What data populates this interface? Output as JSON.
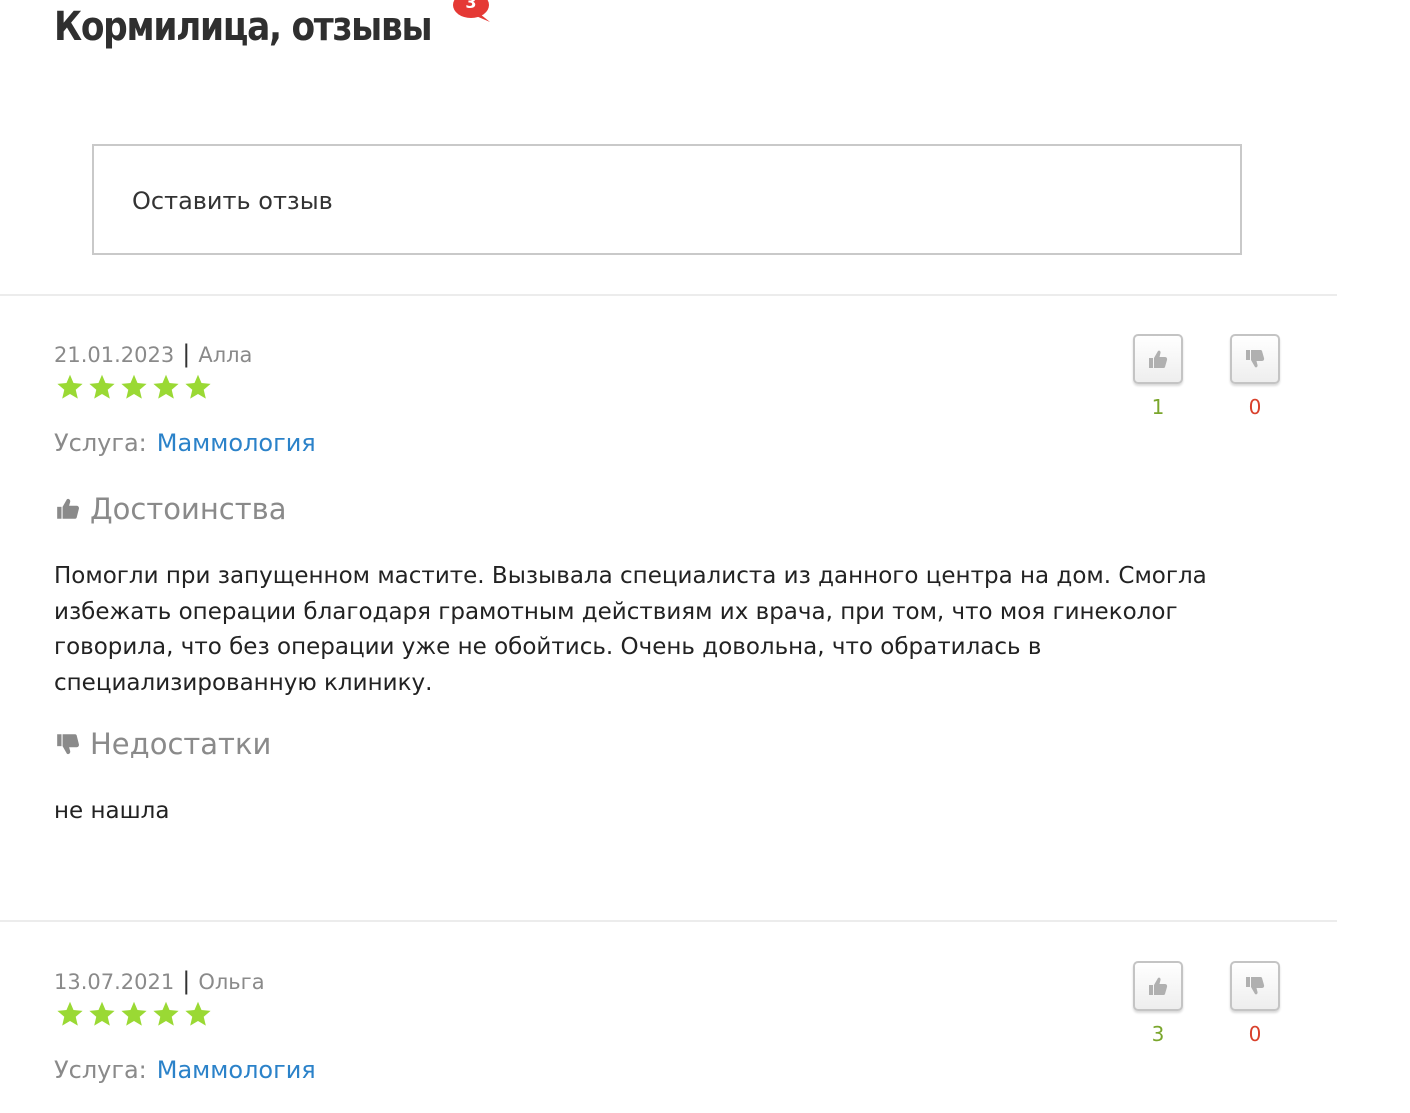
{
  "page": {
    "title": "Кормилица, отзывы",
    "badge_count": "3",
    "leave_review_label": "Оставить отзыв",
    "colors": {
      "star": "#9ad934",
      "link": "#2b82c9",
      "upvote": "#7aa62c",
      "downvote": "#d9402b",
      "badge": "#e53935"
    }
  },
  "reviews": [
    {
      "date": "21.01.2023",
      "author": "Алла",
      "rating": 5,
      "service_label": "Услуга:",
      "service": "Маммология",
      "upvotes": "1",
      "downvotes": "0",
      "pros_heading": "Достоинства",
      "pros_text": "Помогли при запущенном мастите. Вызывала специалиста из данного центра на дом. Смогла избежать операции благодаря грамотным действиям их врача, при том, что моя гинеколог говорила, что без операции уже не обойтись. Очень довольна, что обратилась в специализированную клинику.",
      "cons_heading": "Недостатки",
      "cons_text": "не нашла"
    },
    {
      "date": "13.07.2021",
      "author": "Ольга",
      "rating": 5,
      "service_label": "Услуга:",
      "service": "Маммология",
      "upvotes": "3",
      "downvotes": "0"
    }
  ]
}
